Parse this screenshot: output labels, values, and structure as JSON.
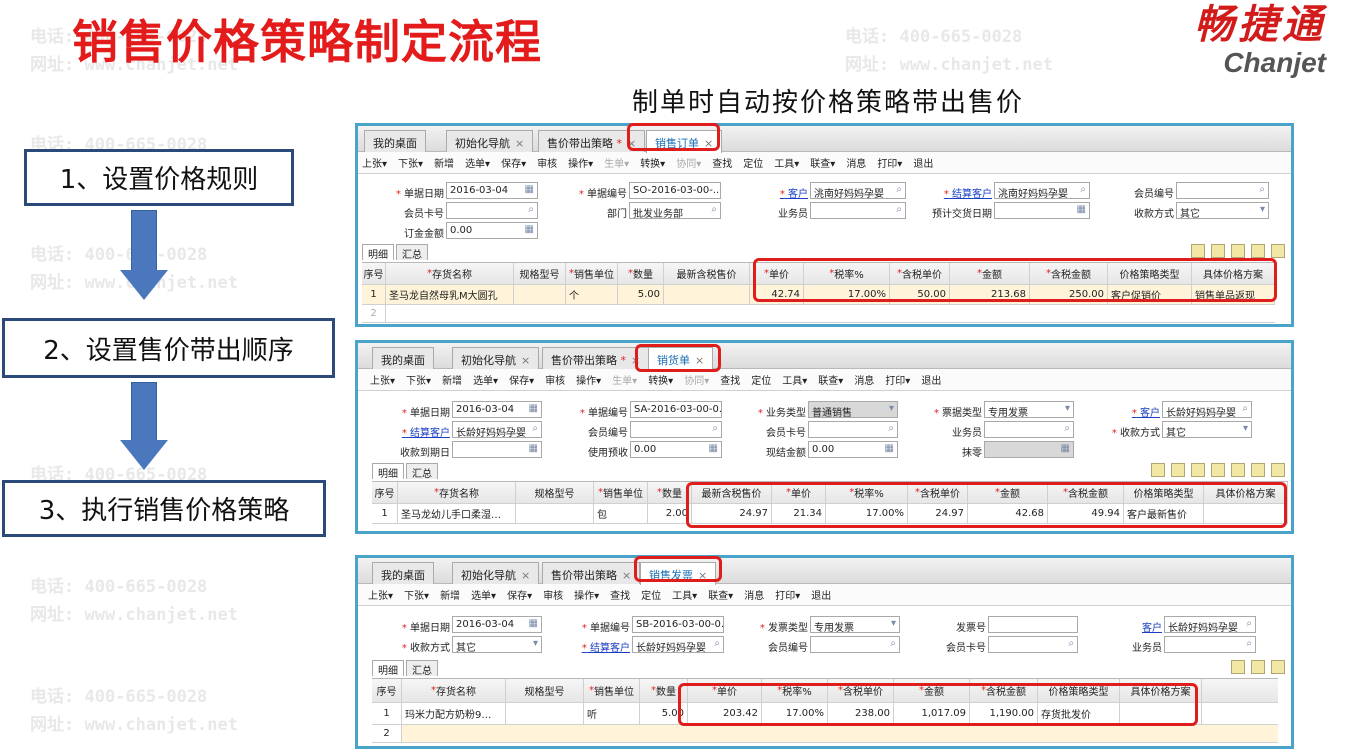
{
  "slide_title": "销售价格策略制定流程",
  "logo": {
    "cn": "畅捷通",
    "en": "Chanjet"
  },
  "subtitle": "制单时自动按价格策略带出售价",
  "steps": [
    "1、设置价格规则",
    "2、设置售价带出顺序",
    "3、执行销售价格策略"
  ],
  "watermark": {
    "phone": "电话: 400-665-0028",
    "web": "网址: www.chanjet.net"
  },
  "panel1": {
    "tabs": [
      "我的桌面",
      "初始化导航",
      "售价带出策略",
      "销售订单"
    ],
    "toolbar": [
      "上张▾",
      "下张▾",
      "新增",
      "选单▾",
      "保存▾",
      "审核",
      "操作▾",
      "生单▾",
      "转换▾",
      "协同▾",
      "查找",
      "定位",
      "工具▾",
      "联查▾",
      "消息",
      "打印▾",
      "退出"
    ],
    "fields": {
      "date_label": "单据日期",
      "date": "2016-03-04",
      "no_label": "单据编号",
      "no": "SO-2016-03-00-...",
      "customer_label": "客户",
      "customer": "洮南好妈妈孕婴",
      "settle_label": "结算客户",
      "settle": "洮南好妈妈孕婴",
      "member_no_label": "会员编号",
      "member_no": "",
      "card_label": "会员卡号",
      "card": "",
      "dept_label": "部门",
      "dept": "批发业务部",
      "sales_label": "业务员",
      "sales": "",
      "delivery_label": "预计交货日期",
      "delivery": "",
      "pay_label": "收款方式",
      "pay": "其它",
      "deposit_label": "订金金额",
      "deposit": "0.00"
    },
    "subtabs": [
      "明细",
      "汇总"
    ],
    "grid_headers": [
      "序号",
      "存货名称",
      "规格型号",
      "销售单位",
      "数量",
      "最新含税售价",
      "单价",
      "税率%",
      "含税单价",
      "金额",
      "含税金额",
      "价格策略类型",
      "具体价格方案"
    ],
    "row1": [
      "1",
      "圣马龙自然母乳M大圆孔",
      "",
      "个",
      "5.00",
      "",
      "42.74",
      "17.00%",
      "50.00",
      "213.68",
      "250.00",
      "客户促销价",
      "销售单品返现"
    ],
    "row2_no": "2"
  },
  "panel2": {
    "tabs": [
      "我的桌面",
      "初始化导航",
      "售价带出策略",
      "销货单"
    ],
    "toolbar": [
      "上张▾",
      "下张▾",
      "新增",
      "选单▾",
      "保存▾",
      "审核",
      "操作▾",
      "生单▾",
      "转换▾",
      "协同▾",
      "查找",
      "定位",
      "工具▾",
      "联查▾",
      "消息",
      "打印▾",
      "退出"
    ],
    "fields": {
      "date_label": "单据日期",
      "date": "2016-03-04",
      "no_label": "单据编号",
      "no": "SA-2016-03-00-0...",
      "biz_label": "业务类型",
      "biz": "普通销售",
      "invoice_type_label": "票据类型",
      "invoice_type": "专用发票",
      "customer_label": "客户",
      "customer": "长龄好妈妈孕婴",
      "settle_label": "结算客户",
      "settle": "长龄好妈妈孕婴",
      "member_no_label": "会员编号",
      "member_no": "",
      "card_label": "会员卡号",
      "card": "",
      "sales_label": "业务员",
      "sales": "",
      "pay_label": "收款方式",
      "pay": "其它",
      "due_label": "收款到期日",
      "due": "",
      "prepay_label": "使用预收",
      "prepay": "0.00",
      "cash_label": "现结金额",
      "cash": "0.00",
      "zero_label": "抹零",
      "zero": ""
    },
    "subtabs": [
      "明细",
      "汇总"
    ],
    "grid_headers": [
      "序号",
      "存货名称",
      "规格型号",
      "销售单位",
      "数量",
      "最新含税售价",
      "单价",
      "税率%",
      "含税单价",
      "金额",
      "含税金额",
      "价格策略类型",
      "具体价格方案"
    ],
    "row1": [
      "1",
      "圣马龙幼儿手口柔湿…",
      "",
      "包",
      "2.00",
      "24.97",
      "21.34",
      "17.00%",
      "24.97",
      "42.68",
      "49.94",
      "客户最新售价",
      ""
    ]
  },
  "panel3": {
    "tabs": [
      "我的桌面",
      "初始化导航",
      "售价带出策略",
      "销售发票"
    ],
    "toolbar": [
      "上张▾",
      "下张▾",
      "新增",
      "选单▾",
      "保存▾",
      "审核",
      "操作▾",
      "查找",
      "定位",
      "工具▾",
      "联查▾",
      "消息",
      "打印▾",
      "退出"
    ],
    "fields": {
      "date_label": "单据日期",
      "date": "2016-03-04",
      "no_label": "单据编号",
      "no": "SB-2016-03-00-0...",
      "invoice_type_label": "发票类型",
      "invoice_type": "专用发票",
      "invoice_no_label": "发票号",
      "invoice_no": "",
      "customer_label": "客户",
      "customer": "长龄好妈妈孕婴",
      "pay_label": "收款方式",
      "pay": "其它",
      "settle_label": "结算客户",
      "settle": "长龄好妈妈孕婴",
      "member_no_label": "会员编号",
      "member_no": "",
      "card_label": "会员卡号",
      "card": "",
      "sales_label": "业务员",
      "sales": ""
    },
    "subtabs": [
      "明细",
      "汇总"
    ],
    "grid_headers": [
      "序号",
      "存货名称",
      "规格型号",
      "销售单位",
      "数量",
      "单价",
      "税率%",
      "含税单价",
      "金额",
      "含税金额",
      "价格策略类型",
      "具体价格方案"
    ],
    "row1": [
      "1",
      "玛米力配方奶粉9…",
      "",
      "听",
      "5.00",
      "203.42",
      "17.00%",
      "238.00",
      "1,017.09",
      "1,190.00",
      "存货批发价",
      ""
    ],
    "row2_no": "2"
  }
}
